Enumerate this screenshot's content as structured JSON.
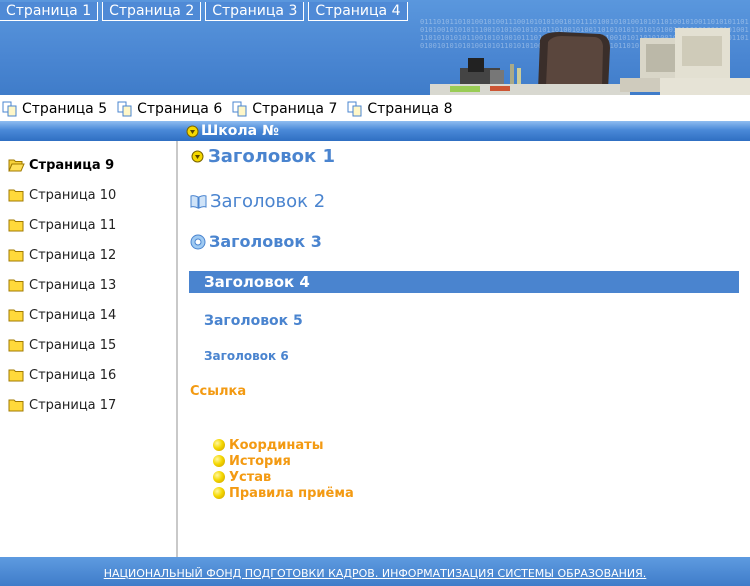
{
  "header": {
    "top_tabs": [
      {
        "label": "Страница 1"
      },
      {
        "label": "Страница 2"
      },
      {
        "label": "Страница 3"
      },
      {
        "label": "Страница 4"
      }
    ],
    "binary_text": "0111010110101001010011100101010100101011101001010100101011010010100110101011010101001010101110010101001010101101001010011010101011010101001011010100101010011101010101011001010100101110101010101001101010010101101010010101010110101011010100101010101001010110101010010101011010100101011010101001"
  },
  "nav2": {
    "items": [
      {
        "label": "Страница 5"
      },
      {
        "label": "Страница 6"
      },
      {
        "label": "Страница 7"
      },
      {
        "label": "Страница 8"
      }
    ]
  },
  "section_title": "Школа №",
  "sidebar": {
    "items": [
      {
        "label": "Страница 9",
        "active": true
      },
      {
        "label": "Страница 10"
      },
      {
        "label": "Страница 11"
      },
      {
        "label": "Страница 12"
      },
      {
        "label": "Страница 13"
      },
      {
        "label": "Страница 14"
      },
      {
        "label": "Страница 15"
      },
      {
        "label": "Страница 16"
      },
      {
        "label": "Страница 17"
      }
    ]
  },
  "main": {
    "headings": {
      "h1": "Заголовок 1",
      "h2": "Заголовок 2",
      "h3": "Заголовок 3",
      "h4": "Заголовок 4",
      "h5": "Заголовок 5",
      "h6": "Заголовок 6"
    },
    "link": "Ссылка",
    "bullets": [
      {
        "label": "Координаты"
      },
      {
        "label": "История"
      },
      {
        "label": "Устав"
      },
      {
        "label": "Правила приёма"
      }
    ]
  },
  "footer": {
    "link": "НАЦИОНАЛЬНЫЙ ФОНД ПОДГОТОВКИ КАДРОВ. ИНФОРМАТИЗАЦИЯ СИСТЕМЫ ОБРАЗОВАНИЯ."
  },
  "colors": {
    "brand_blue": "#4a84cf",
    "link_orange": "#f39a12"
  }
}
